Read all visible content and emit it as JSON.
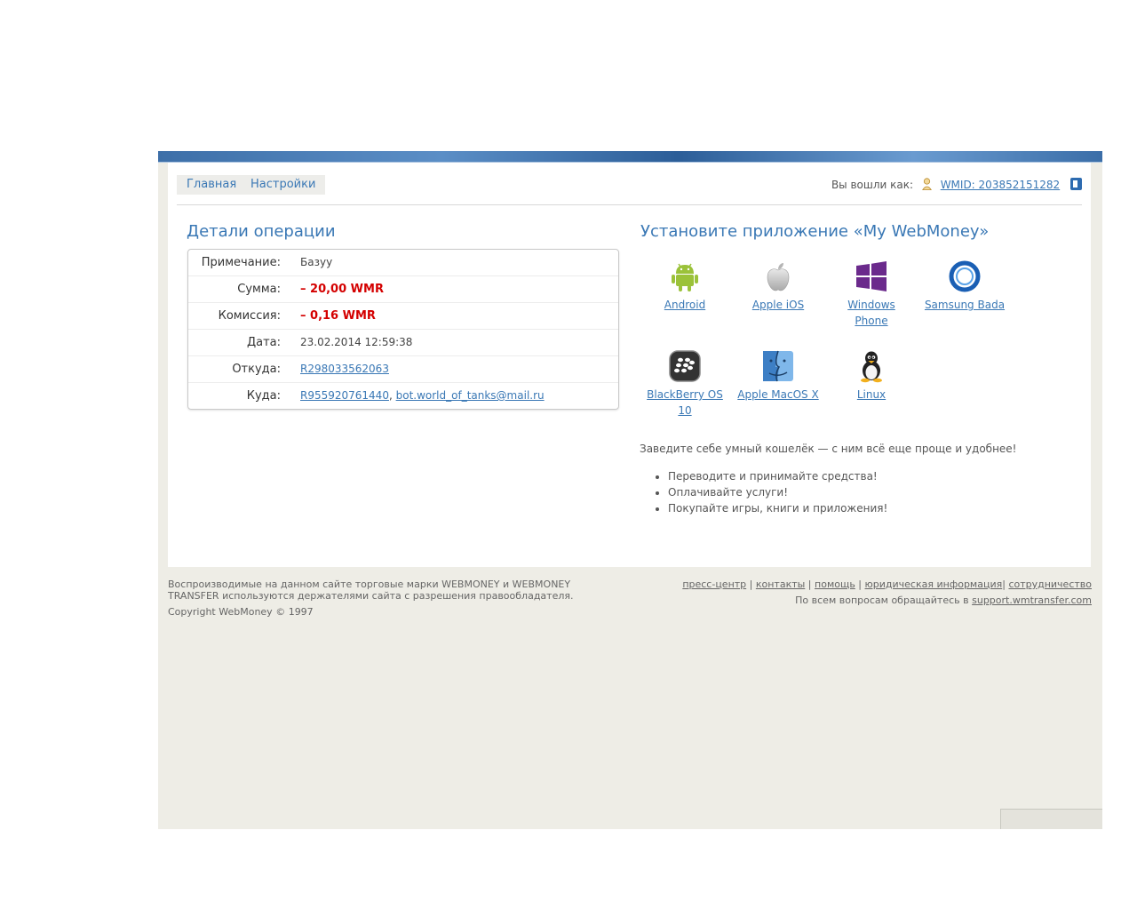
{
  "nav": {
    "tabs": [
      "Главная",
      "Настройки"
    ]
  },
  "login": {
    "label": "Вы вошли как:",
    "wmid": "WMID: 203852151282"
  },
  "details": {
    "title": "Детали операции",
    "rows": [
      {
        "label": "Примечание:",
        "value": "Базуу"
      },
      {
        "label": "Сумма:",
        "value": "– 20,00 WMR"
      },
      {
        "label": "Комиссия:",
        "value": "– 0,16 WMR"
      },
      {
        "label": "Дата:",
        "value": "23.02.2014 12:59:38"
      },
      {
        "label": "Откуда:",
        "value": "R298033562063"
      },
      {
        "label": "Куда:",
        "purse": "R955920761440",
        "separator": ", ",
        "email": "bot.world_of_tanks@mail.ru"
      }
    ]
  },
  "install": {
    "title": "Установите приложение «My WebMoney»",
    "apps": [
      {
        "label": "Android",
        "icon": "android-icon"
      },
      {
        "label": "Apple iOS",
        "icon": "apple-icon"
      },
      {
        "label": "Windows Phone",
        "icon": "windows-icon"
      },
      {
        "label": "Samsung Bada",
        "icon": "bada-icon"
      },
      {
        "label": "BlackBerry OS 10",
        "icon": "blackberry-icon"
      },
      {
        "label": "Apple MacOS X",
        "icon": "finder-icon"
      },
      {
        "label": "Linux",
        "icon": "tux-icon"
      }
    ],
    "promo": "Заведите себе умный кошелёк — с ним всё еще проще и удобнее!",
    "bullets": [
      "Переводите и принимайте средства!",
      "Оплачивайте услуги!",
      "Покупайте игры, книги и приложения!"
    ]
  },
  "footer": {
    "trademark": "Воспроизводимые на данном сайте торговые марки WEBMONEY и WEBMONEY TRANSFER используются держателями сайта с разрешения правообладателя.",
    "copyright": "Copyright WebMoney © 1997",
    "links": [
      "пресс-центр",
      "контакты",
      "помощь",
      "юридическая информация",
      "сотрудничество"
    ],
    "support_text": "По всем вопросам обращайтесь в",
    "support_link": "support.wmtransfer.com"
  },
  "colors": {
    "accent": "#3a78b5",
    "negative": "#d40000",
    "background": "#eeede6"
  }
}
